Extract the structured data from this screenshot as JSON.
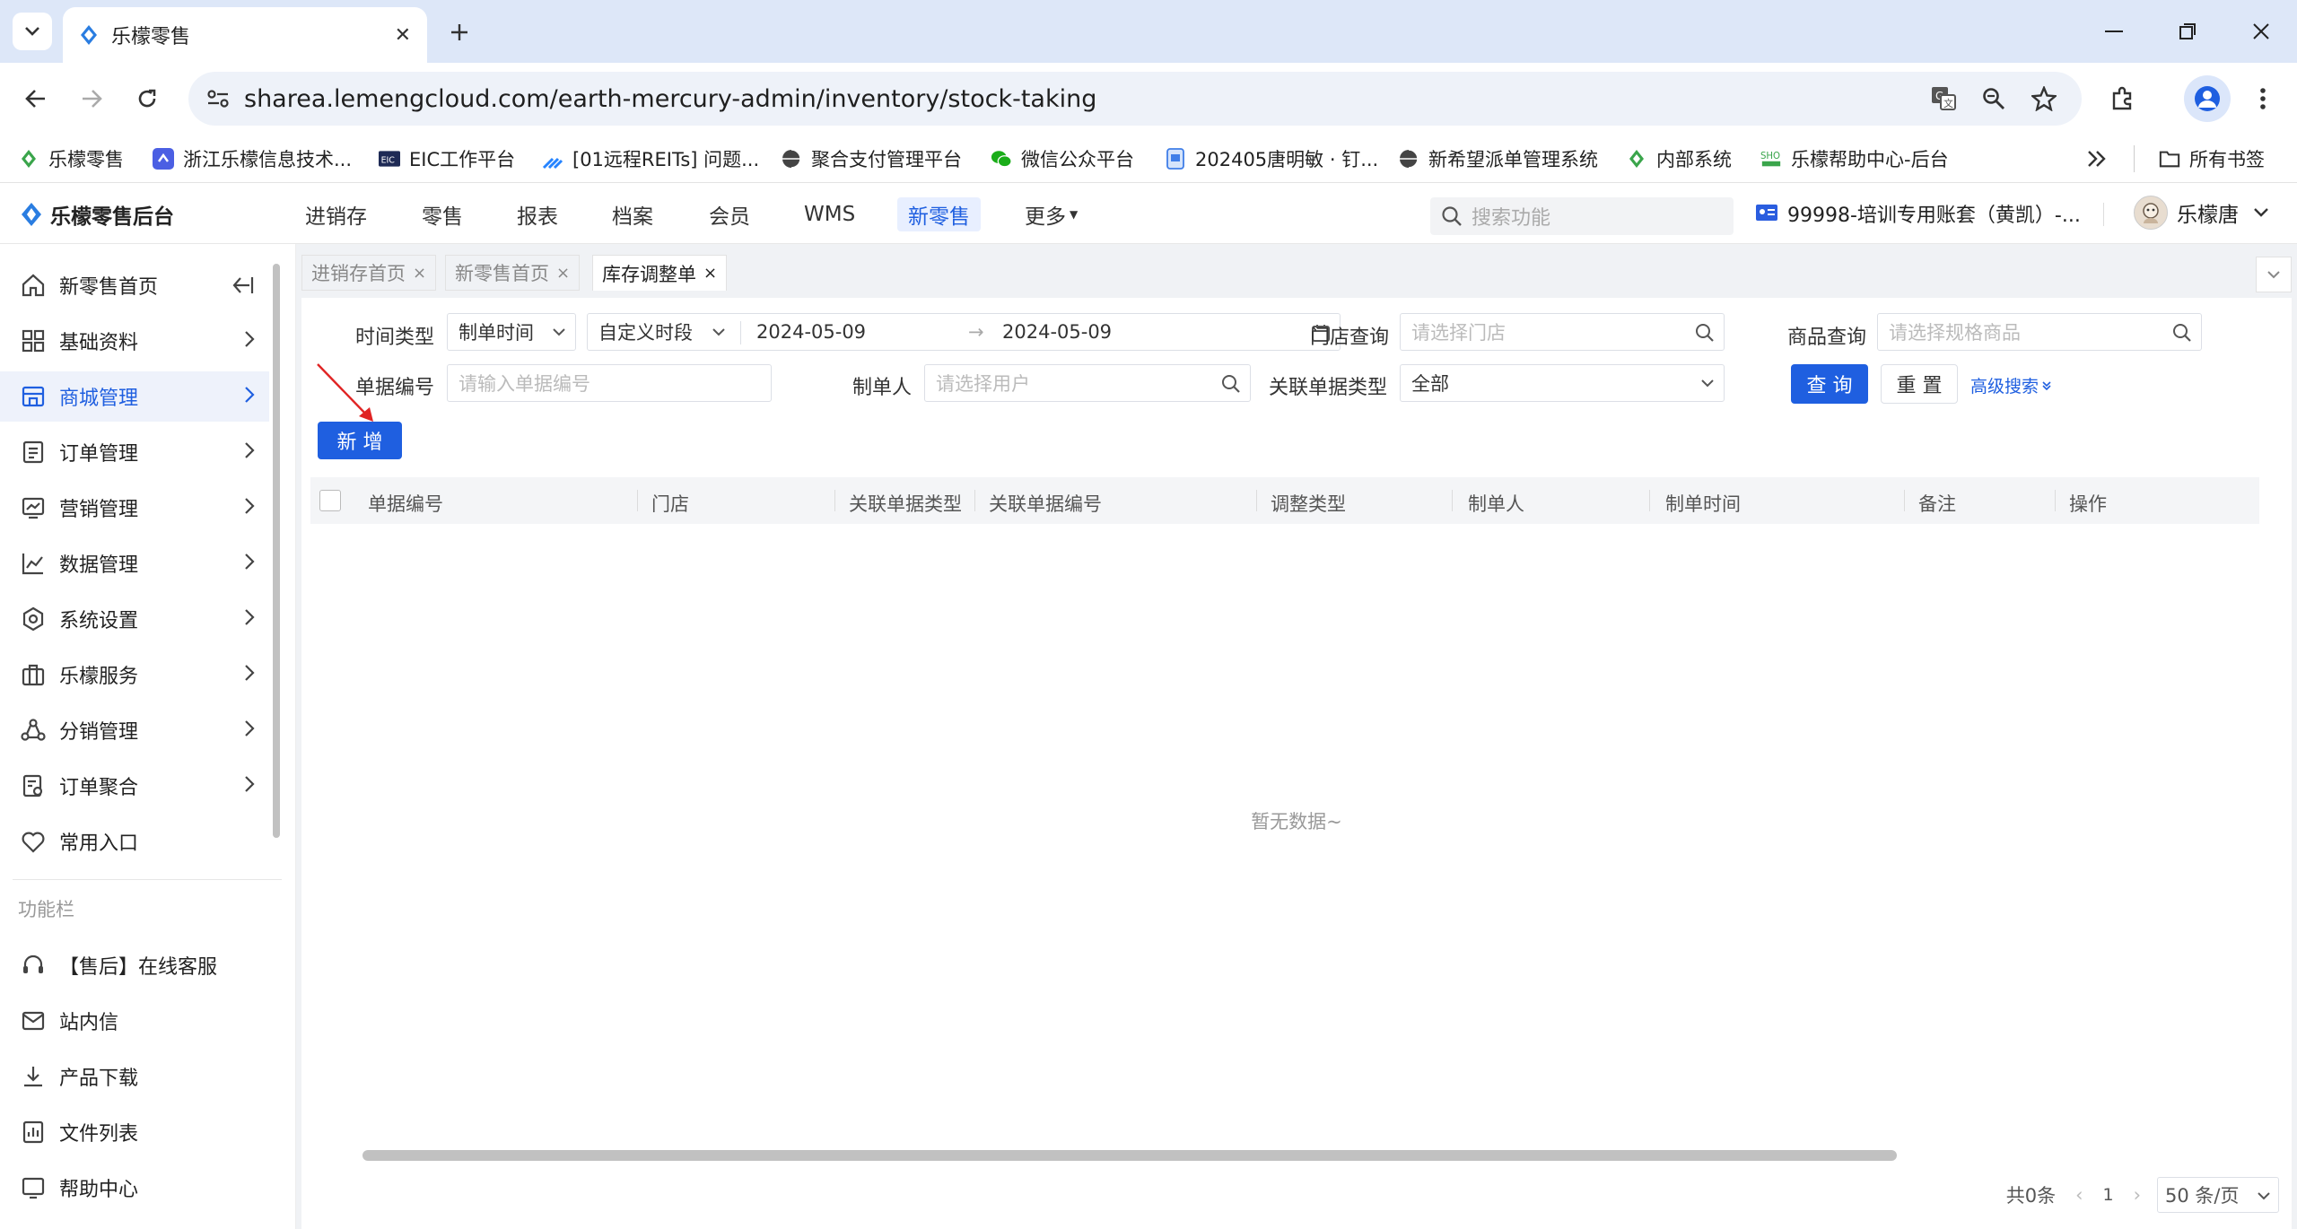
{
  "browser": {
    "tab_title": "乐檬零售",
    "url": "sharea.lemengcloud.com/earth-mercury-admin/inventory/stock-taking",
    "bookmarks": [
      {
        "label": "乐檬零售",
        "icon": "lemon-leaf-icon"
      },
      {
        "label": "浙江乐檬信息技术...",
        "icon": "blue-square-icon"
      },
      {
        "label": "EIC工作平台",
        "icon": "eic-logo-icon"
      },
      {
        "label": "[01远程REITs] 问题...",
        "icon": "jira-icon"
      },
      {
        "label": "聚合支付管理平台",
        "icon": "globe-icon"
      },
      {
        "label": "微信公众平台",
        "icon": "wechat-icon"
      },
      {
        "label": "202405唐明敏 · 钉...",
        "icon": "doc-icon"
      },
      {
        "label": "新希望派单管理系统",
        "icon": "globe-icon"
      },
      {
        "label": "内部系统",
        "icon": "lemon-leaf-icon"
      },
      {
        "label": "乐檬帮助中心-后台",
        "icon": "help-logo-icon"
      }
    ],
    "all_bookmarks": "所有书签"
  },
  "app": {
    "logo_text": "乐檬零售后台",
    "nav": [
      "进销存",
      "零售",
      "报表",
      "档案",
      "会员",
      "WMS",
      "新零售",
      "更多"
    ],
    "active_nav": "新零售",
    "search_placeholder": "搜索功能",
    "account": "99998-培训专用账套（黄凯）-...",
    "user": "乐檬唐"
  },
  "sidebar": {
    "items": [
      {
        "label": "新零售首页",
        "icon": "home-icon"
      },
      {
        "label": "基础资料",
        "icon": "grid-icon"
      },
      {
        "label": "商城管理",
        "icon": "store-icon"
      },
      {
        "label": "订单管理",
        "icon": "order-icon"
      },
      {
        "label": "营销管理",
        "icon": "marketing-icon"
      },
      {
        "label": "数据管理",
        "icon": "chart-line-icon"
      },
      {
        "label": "系统设置",
        "icon": "settings-icon"
      },
      {
        "label": "乐檬服务",
        "icon": "briefcase-icon"
      },
      {
        "label": "分销管理",
        "icon": "distribution-icon"
      },
      {
        "label": "订单聚合",
        "icon": "aggregate-icon"
      },
      {
        "label": "常用入口",
        "icon": "heart-icon"
      }
    ],
    "section_label": "功能栏",
    "func_items": [
      {
        "label": "【售后】在线客服",
        "icon": "headset-icon"
      },
      {
        "label": "站内信",
        "icon": "mail-icon"
      },
      {
        "label": "产品下载",
        "icon": "download-icon"
      },
      {
        "label": "文件列表",
        "icon": "file-list-icon"
      },
      {
        "label": "帮助中心",
        "icon": "help-icon"
      }
    ]
  },
  "page_tabs": [
    "进销存首页",
    "新零售首页",
    "库存调整单"
  ],
  "filters": {
    "time_type_label": "时间类型",
    "time_type_value": "制单时间",
    "period_value": "自定义时段",
    "date_start": "2024-05-09",
    "date_end": "2024-05-09",
    "store_label": "门店查询",
    "store_placeholder": "请选择门店",
    "product_label": "商品查询",
    "product_placeholder": "请选择规格商品",
    "doc_no_label": "单据编号",
    "doc_no_placeholder": "请输入单据编号",
    "creator_label": "制单人",
    "creator_placeholder": "请选择用户",
    "related_type_label": "关联单据类型",
    "related_type_value": "全部",
    "query_btn": "查 询",
    "reset_btn": "重 置",
    "advanced": "高级搜索"
  },
  "add_btn": "新 增",
  "table": {
    "columns": [
      "单据编号",
      "门店",
      "关联单据类型",
      "关联单据编号",
      "调整类型",
      "制单人",
      "制单时间",
      "备注",
      "操作"
    ],
    "empty_text": "暂无数据~"
  },
  "pagination": {
    "total": "共0条",
    "page": "1",
    "page_size": "50 条/页"
  }
}
